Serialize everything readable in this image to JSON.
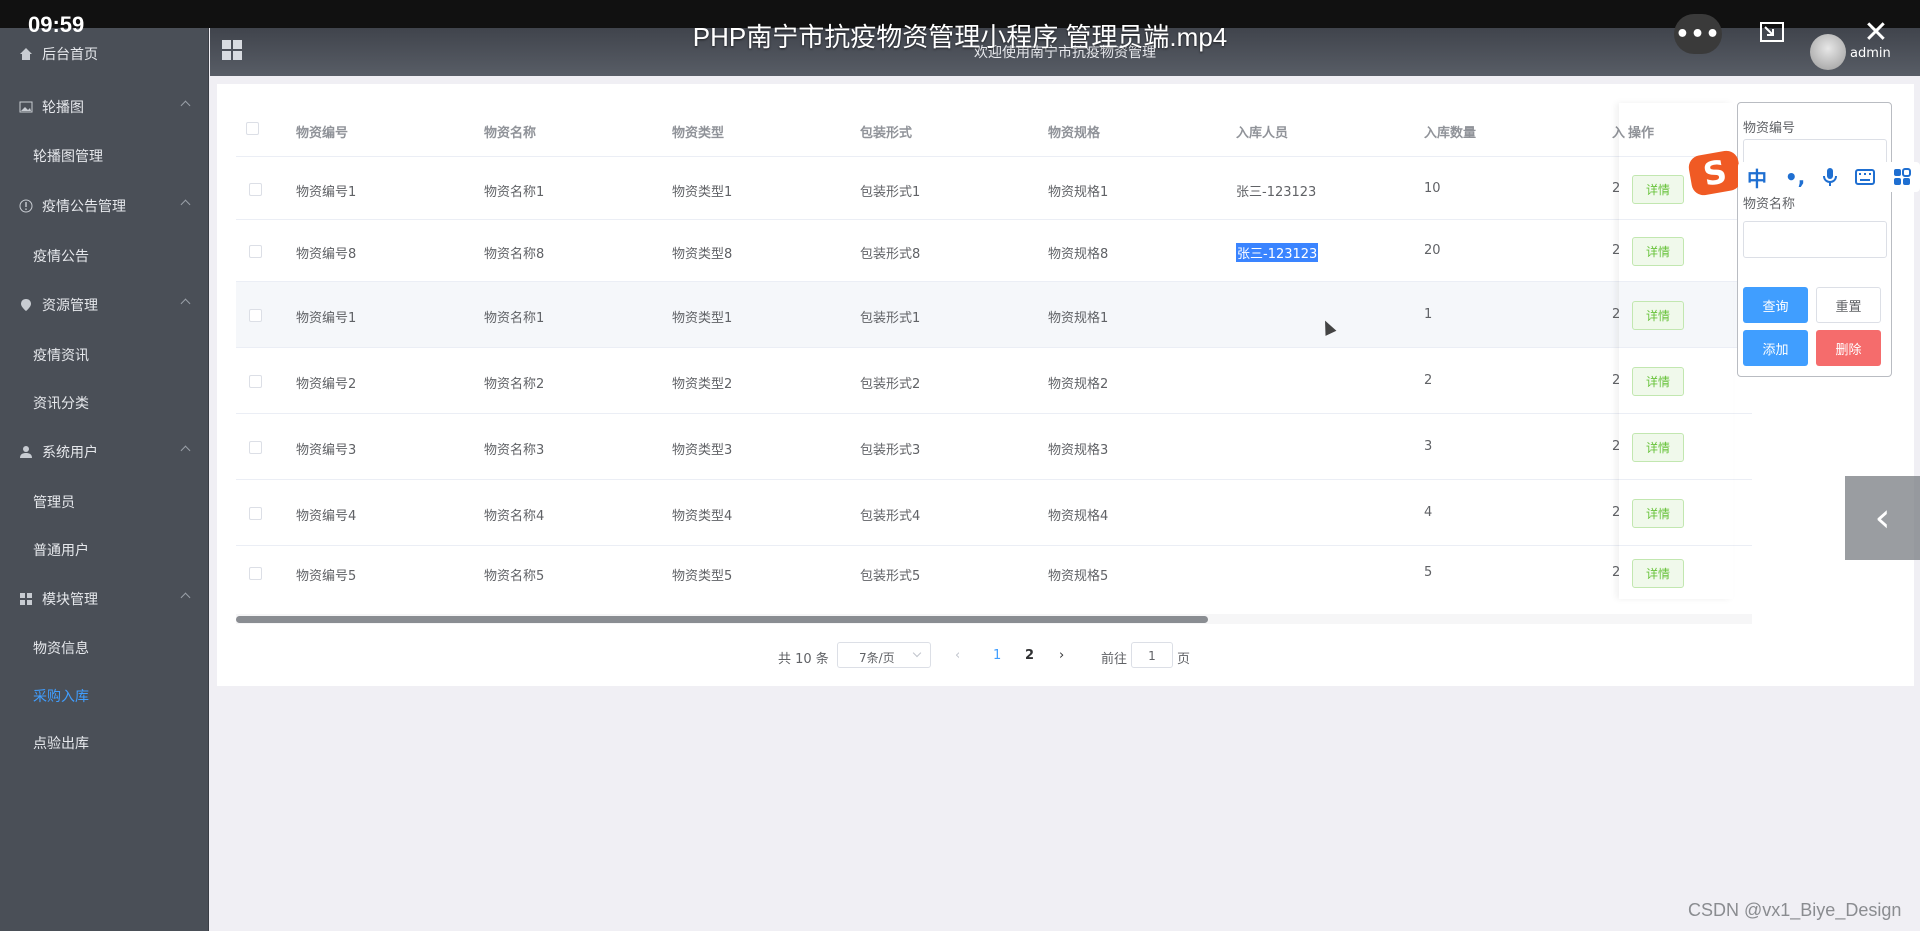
{
  "overlay": {
    "time": "09:59",
    "title": "PHP南宁市抗疫物资管理小程序 管理员端.mp4",
    "more_icon": "more-dots-icon",
    "pip_icon": "picture-in-picture-icon",
    "close_icon": "close-icon"
  },
  "header": {
    "welcome": "欢迎使用南宁市抗疫物资管理",
    "user": "admin"
  },
  "sidebar": {
    "home": "后台首页",
    "carousel": {
      "label": "轮播图",
      "items": [
        "轮播图管理"
      ]
    },
    "notice": {
      "label": "疫情公告管理",
      "items": [
        "疫情公告"
      ]
    },
    "resource": {
      "label": "资源管理",
      "items": [
        "疫情资讯",
        "资讯分类"
      ]
    },
    "users": {
      "label": "系统用户",
      "items": [
        "管理员",
        "普通用户"
      ]
    },
    "modules": {
      "label": "模块管理",
      "items": [
        "物资信息",
        "采购入库",
        "点验出库"
      ]
    },
    "active_item": "采购入库"
  },
  "table": {
    "columns": [
      "物资编号",
      "物资名称",
      "物资类型",
      "包装形式",
      "物资规格",
      "入库人员",
      "入库数量",
      "入",
      "操作"
    ],
    "detail_label": "详情",
    "rows": [
      {
        "code": "物资编号1",
        "name": "物资名称1",
        "type": "物资类型1",
        "pack": "包装形式1",
        "spec": "物资规格1",
        "staff": "张三-123123",
        "qty": "10",
        "col8": "2"
      },
      {
        "code": "物资编号8",
        "name": "物资名称8",
        "type": "物资类型8",
        "pack": "包装形式8",
        "spec": "物资规格8",
        "staff": "张三-123123",
        "qty": "20",
        "col8": "2"
      },
      {
        "code": "物资编号1",
        "name": "物资名称1",
        "type": "物资类型1",
        "pack": "包装形式1",
        "spec": "物资规格1",
        "staff": "",
        "qty": "1",
        "col8": "2"
      },
      {
        "code": "物资编号2",
        "name": "物资名称2",
        "type": "物资类型2",
        "pack": "包装形式2",
        "spec": "物资规格2",
        "staff": "",
        "qty": "2",
        "col8": "2"
      },
      {
        "code": "物资编号3",
        "name": "物资名称3",
        "type": "物资类型3",
        "pack": "包装形式3",
        "spec": "物资规格3",
        "staff": "",
        "qty": "3",
        "col8": "2"
      },
      {
        "code": "物资编号4",
        "name": "物资名称4",
        "type": "物资类型4",
        "pack": "包装形式4",
        "spec": "物资规格4",
        "staff": "",
        "qty": "4",
        "col8": "2"
      },
      {
        "code": "物资编号5",
        "name": "物资名称5",
        "type": "物资类型5",
        "pack": "包装形式5",
        "spec": "物资规格5",
        "staff": "",
        "qty": "5",
        "col8": "2"
      }
    ]
  },
  "pagination": {
    "total": "共 10 条",
    "page_size": "7条/页",
    "pages": [
      "1",
      "2"
    ],
    "current_page": "1",
    "goto_prefix": "前往",
    "goto_value": "1",
    "goto_suffix": "页"
  },
  "search": {
    "field1_label": "物资编号",
    "field2_label": "物资名称",
    "query": "查询",
    "reset": "重置",
    "add": "添加",
    "delete": "删除"
  },
  "ime": {
    "logo": "S",
    "lang": "中",
    "punct": "•,",
    "icons": [
      "microphone-icon",
      "keyboard-icon",
      "apps-grid-icon"
    ]
  },
  "watermark": "CSDN @vx1_Biye_Design",
  "colors": {
    "primary": "#409eff",
    "danger": "#f56c6c",
    "success": "#67c23a",
    "sidebar_bg": "#4a4f57"
  }
}
